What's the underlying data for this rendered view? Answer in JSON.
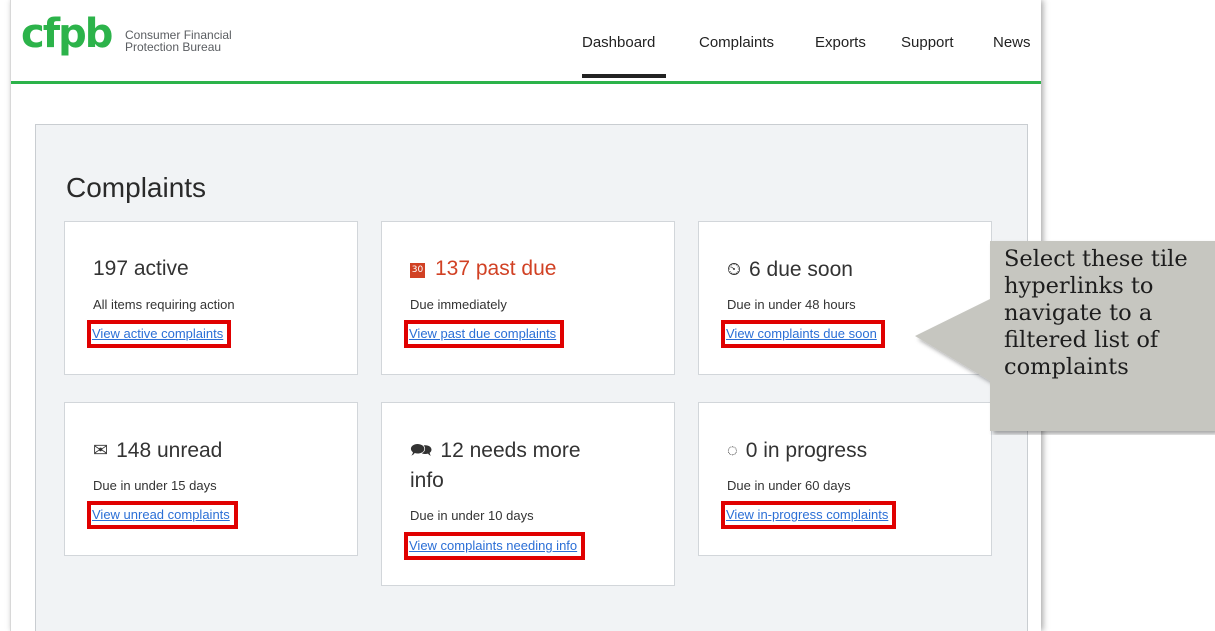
{
  "brand": {
    "logo_text": "cfpb",
    "org_line1": "Consumer Financial",
    "org_line2": "Protection Bureau",
    "accent_color": "#2cb34a"
  },
  "nav": {
    "items": [
      {
        "label": "Dashboard",
        "active": true
      },
      {
        "label": "Complaints",
        "active": false
      },
      {
        "label": "Exports",
        "active": false
      },
      {
        "label": "Support",
        "active": false
      },
      {
        "label": "News",
        "active": false
      }
    ]
  },
  "main": {
    "title": "Complaints",
    "tiles": [
      {
        "icon": "",
        "heading": "197 active",
        "subtitle": "All items requiring action",
        "link": "View active complaints"
      },
      {
        "icon": "calendar-icon",
        "icon_glyph": "30",
        "heading": "137 past due",
        "subtitle": "Due immediately",
        "link": "View past due complaints",
        "heading_color": "#d14124"
      },
      {
        "icon": "clock-icon",
        "icon_glyph": "⏲",
        "heading": "6 due soon",
        "subtitle": "Due in under 48 hours",
        "link": "View complaints due soon"
      },
      {
        "icon": "envelope-icon",
        "icon_glyph": "✉",
        "heading": "148 unread",
        "subtitle": "Due in under 15 days",
        "link": "View unread complaints"
      },
      {
        "icon": "chat-icon",
        "icon_glyph": "🗪",
        "heading_line1": "12 needs more",
        "heading_line2": "info",
        "subtitle": "Due in under 10 days",
        "link": "View complaints needing info"
      },
      {
        "icon": "progress-icon",
        "icon_glyph": "◌",
        "heading": "0 in progress",
        "subtitle": "Due in under 60 days",
        "link": "View in-progress complaints"
      }
    ]
  },
  "callout": {
    "line1": "Select these tile",
    "line2": "hyperlinks to",
    "line3": "navigate to a",
    "line4": "filtered list of",
    "line5": "complaints"
  }
}
